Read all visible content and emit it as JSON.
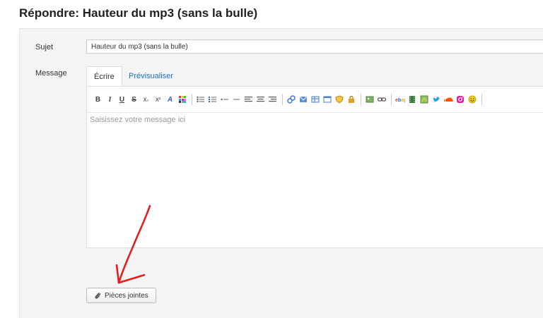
{
  "page": {
    "title": "Répondre: Hauteur du mp3 (sans la bulle)"
  },
  "form": {
    "subject_label": "Sujet",
    "subject_value": "Hauteur du mp3 (sans la bulle)",
    "message_label": "Message",
    "tabs": [
      {
        "label": "Écrire",
        "active": true
      },
      {
        "label": "Prévisualiser",
        "active": false
      }
    ],
    "message_placeholder": "Saisissez votre message ici",
    "attach_label": "Pièces jointes"
  },
  "toolbar": {
    "bold": "B",
    "italic": "I",
    "underline": "U",
    "strike": "S",
    "subscript": "x",
    "subscript_mark": "₂",
    "superscript": "x",
    "superscript_mark": "²",
    "font": "A"
  },
  "colors": {
    "accent_link": "#1a73c8",
    "annotation_arrow": "#e02020"
  }
}
